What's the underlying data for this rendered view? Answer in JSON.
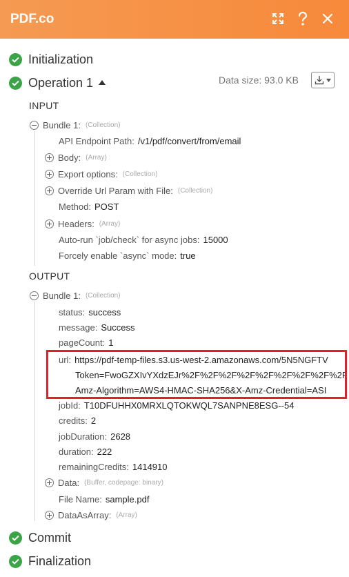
{
  "header": {
    "title": "PDF.co"
  },
  "sections": {
    "initialization": "Initialization",
    "operation": "Operation 1",
    "commit": "Commit",
    "finalization": "Finalization"
  },
  "data_size": "Data size: 93.0 KB",
  "input": {
    "heading": "INPUT",
    "bundle": {
      "key": "Bundle 1:",
      "type": "(Collection)"
    },
    "rows": [
      {
        "key": "API Endpoint Path:",
        "value": "/v1/pdf/convert/from/email"
      },
      {
        "key": "Body:",
        "type": "(Array)"
      },
      {
        "key": "Export options:",
        "type": "(Collection)"
      },
      {
        "key": "Override Url Param with File:",
        "type": "(Collection)"
      },
      {
        "key": "Method:",
        "value": "POST"
      },
      {
        "key": "Headers:",
        "type": "(Array)"
      },
      {
        "key": "Auto-run `job/check` for async jobs:",
        "value": "15000"
      },
      {
        "key": "Forcely enable `async` mode:",
        "value": "true"
      }
    ]
  },
  "output": {
    "heading": "OUTPUT",
    "bundle": {
      "key": "Bundle 1:",
      "type": "(Collection)"
    },
    "rows": [
      {
        "key": "status:",
        "value": "success"
      },
      {
        "key": "message:",
        "value": "Success"
      },
      {
        "key": "pageCount:",
        "value": "1"
      },
      {
        "key": "url:",
        "value": "https://pdf-temp-files.s3.us-west-2.amazonaws.com/5N5NGFTV"
      },
      {
        "key": "",
        "value": "Token=FwoGZXIvYXdzEJr%2F%2F%2F%2F%2F%2F%2F%2F%2F%2F"
      },
      {
        "key": "",
        "value": "Amz-Algorithm=AWS4-HMAC-SHA256&X-Amz-Credential=ASI"
      },
      {
        "key": "jobId:",
        "value": "T10DFUHHX0MRXLQTOKWQL7SANPNE8ESG--54"
      },
      {
        "key": "credits:",
        "value": "2"
      },
      {
        "key": "jobDuration:",
        "value": "2628"
      },
      {
        "key": "duration:",
        "value": "222"
      },
      {
        "key": "remainingCredits:",
        "value": "1414910"
      },
      {
        "key": "Data:",
        "type": "(Buffer, codepage: binary)"
      },
      {
        "key": "File Name:",
        "value": "sample.pdf"
      },
      {
        "key": "DataAsArray:",
        "type": "(Array)"
      }
    ]
  }
}
